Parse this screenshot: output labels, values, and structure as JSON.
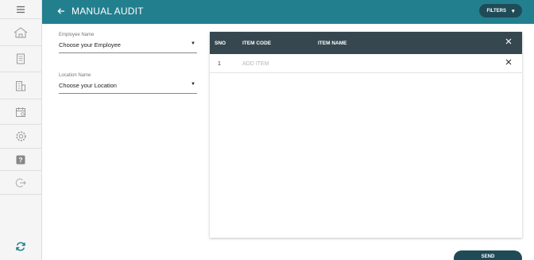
{
  "header": {
    "title": "MANUAL AUDIT",
    "filters_label": "FILTERS",
    "bg_color": "#227f8e"
  },
  "sidebar": {
    "items": [
      {
        "icon": "menu-icon"
      },
      {
        "icon": "home-icon"
      },
      {
        "icon": "document-icon"
      },
      {
        "icon": "building-icon"
      },
      {
        "icon": "calendar-icon"
      },
      {
        "icon": "gear-icon"
      },
      {
        "icon": "help-icon"
      },
      {
        "icon": "logout-icon"
      }
    ],
    "bottom_icon": "sync-icon"
  },
  "form": {
    "employee": {
      "label": "Employee Name",
      "value": "Choose your Employee"
    },
    "location": {
      "label": "Location Name",
      "value": "Choose your Location"
    }
  },
  "table": {
    "columns": [
      "SNO",
      "ITEM CODE",
      "ITEM NAME"
    ],
    "rows": [
      {
        "sno": "1",
        "placeholder": "ADD ITEM"
      }
    ]
  },
  "actions": {
    "send_label": "SEND",
    "accent": "#1f4b57"
  }
}
